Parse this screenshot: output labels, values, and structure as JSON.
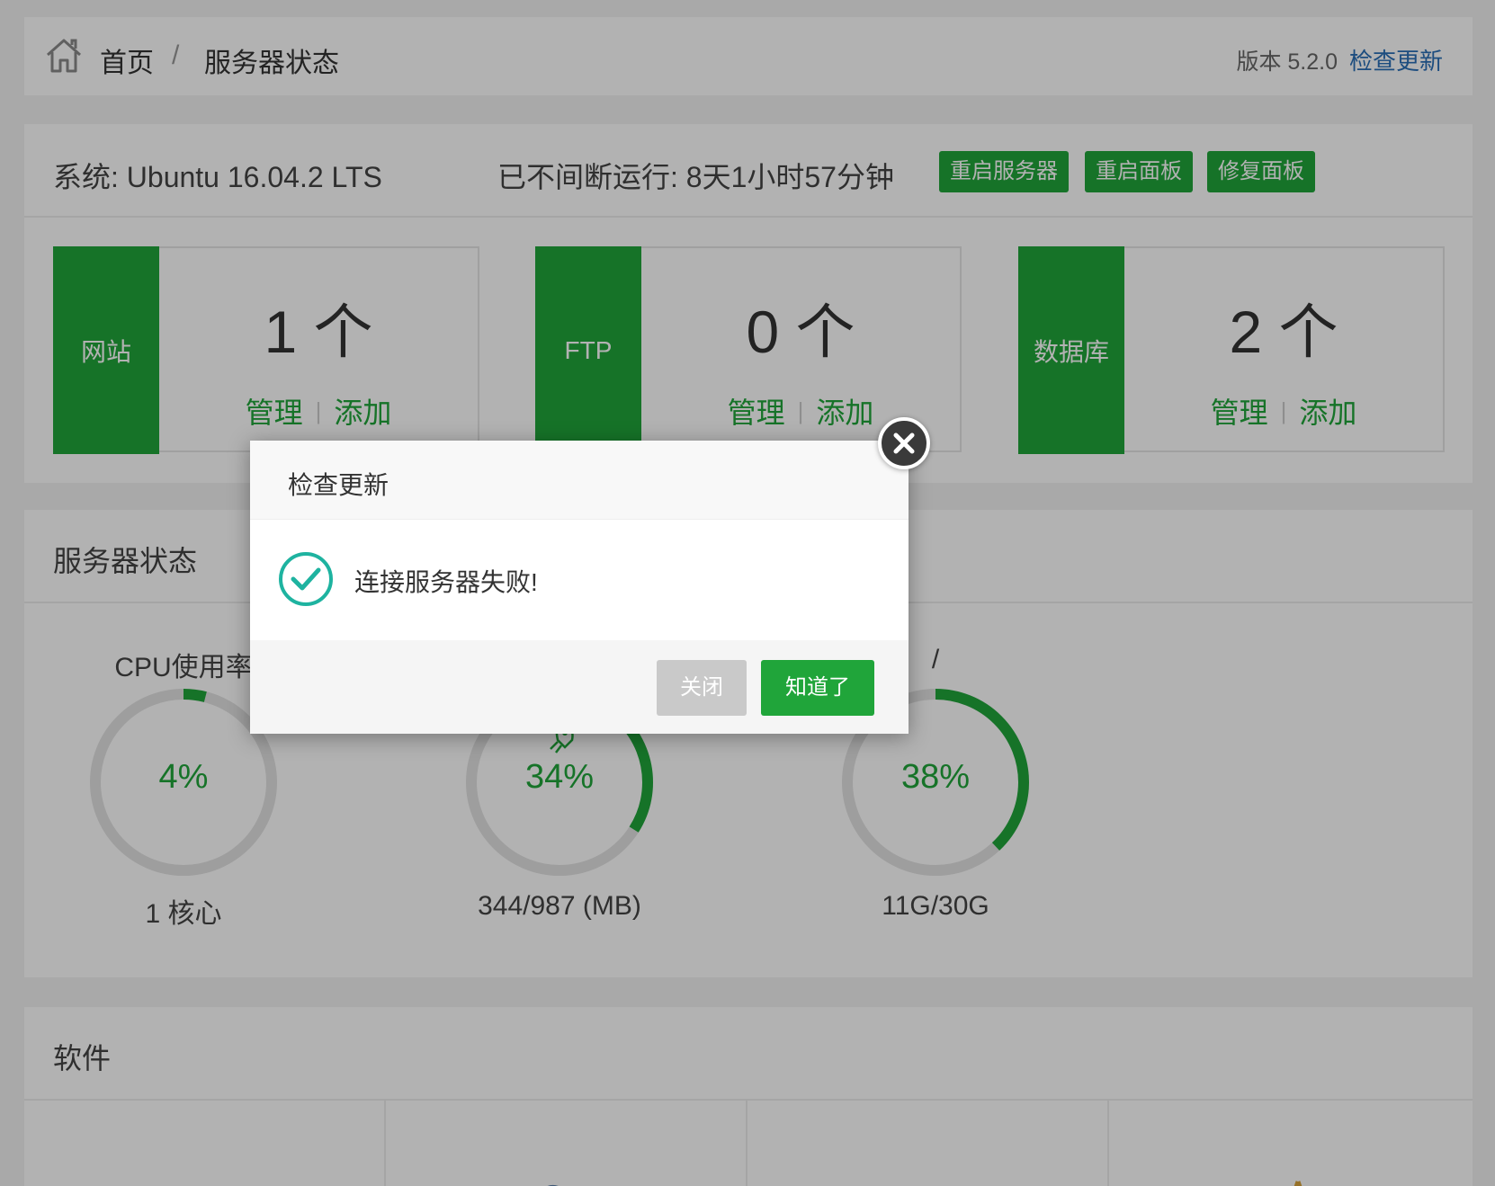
{
  "breadcrumb": {
    "home": "首页",
    "separator": "/",
    "current": "服务器状态"
  },
  "version": {
    "label": "版本 5.2.0",
    "check_update": "检查更新"
  },
  "system": {
    "os": "系统: Ubuntu 16.04.2 LTS",
    "uptime": "已不间断运行: 8天1小时57分钟",
    "buttons": [
      "重启服务器",
      "重启面板",
      "修复面板"
    ]
  },
  "stats": [
    {
      "tag": "网站",
      "count": "1 个",
      "manage": "管理",
      "add": "添加"
    },
    {
      "tag": "FTP",
      "count": "0 个",
      "manage": "管理",
      "add": "添加"
    },
    {
      "tag": "数据库",
      "count": "2 个",
      "manage": "管理",
      "add": "添加"
    }
  ],
  "server_status": {
    "title": "服务器状态",
    "gauges": [
      {
        "label": "CPU使用率",
        "percent": 4,
        "percent_text": "4%",
        "sub": "1 核心"
      },
      {
        "label": "",
        "percent": 34,
        "percent_text": "34%",
        "sub": "344/987 (MB)"
      },
      {
        "label": "/",
        "percent": 38,
        "percent_text": "38%",
        "sub": "11G/30G"
      }
    ]
  },
  "software": {
    "title": "软件"
  },
  "dialog": {
    "title": "检查更新",
    "message": "连接服务器失败!",
    "close_label": "关闭",
    "ok_label": "知道了"
  },
  "colors": {
    "accent": "#20a53a",
    "link": "#2a6fb6",
    "ring_track": "#e2e2e2"
  },
  "icons": [
    "home-icon",
    "success-check-icon",
    "close-x-icon",
    "rocket-icon"
  ]
}
